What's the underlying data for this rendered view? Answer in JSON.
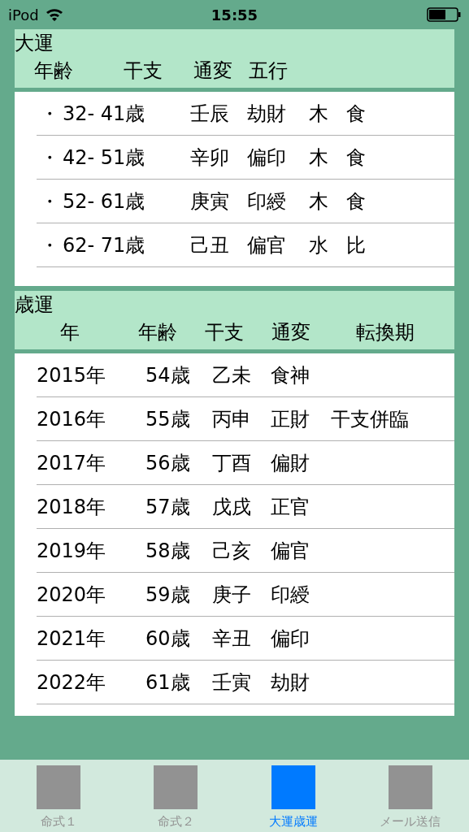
{
  "status_bar": {
    "carrier": "iPod",
    "time": "15:55"
  },
  "taiun": {
    "title": "大運",
    "columns": [
      "年齢",
      "干支",
      "通変",
      "五行"
    ],
    "rows": [
      {
        "bullet": "・",
        "age": "32- 41歳",
        "kanshi": "壬辰",
        "tsuhen": "劫財",
        "gogyo": "木",
        "extra": "食"
      },
      {
        "bullet": "・",
        "age": "42- 51歳",
        "kanshi": "辛卯",
        "tsuhen": "偏印",
        "gogyo": "木",
        "extra": "食"
      },
      {
        "bullet": "・",
        "age": "52- 61歳",
        "kanshi": "庚寅",
        "tsuhen": "印綬",
        "gogyo": "木",
        "extra": "食"
      },
      {
        "bullet": "・",
        "age": "62- 71歳",
        "kanshi": "己丑",
        "tsuhen": "偏官",
        "gogyo": "水",
        "extra": "比"
      }
    ]
  },
  "saiun": {
    "title": "歳運",
    "columns": [
      "年",
      "年齢",
      "干支",
      "通変",
      "転換期"
    ],
    "rows": [
      {
        "year": "2015年",
        "age": "54歳",
        "kanshi": "乙未",
        "tsuhen": "食神"
      },
      {
        "year": "2016年",
        "age": "55歳",
        "kanshi": "丙申",
        "tsuhen": "正財",
        "tenkan": "干支併臨"
      },
      {
        "year": "2017年",
        "age": "56歳",
        "kanshi": "丁酉",
        "tsuhen": "偏財"
      },
      {
        "year": "2018年",
        "age": "57歳",
        "kanshi": "戊戌",
        "tsuhen": "正官"
      },
      {
        "year": "2019年",
        "age": "58歳",
        "kanshi": "己亥",
        "tsuhen": "偏官"
      },
      {
        "year": "2020年",
        "age": "59歳",
        "kanshi": "庚子",
        "tsuhen": "印綬"
      },
      {
        "year": "2021年",
        "age": "60歳",
        "kanshi": "辛丑",
        "tsuhen": "偏印"
      },
      {
        "year": "2022年",
        "age": "61歳",
        "kanshi": "壬寅",
        "tsuhen": "劫財"
      }
    ]
  },
  "tabs": [
    {
      "label": "命式１",
      "selected": false
    },
    {
      "label": "命式２",
      "selected": false
    },
    {
      "label": "大運歳運",
      "selected": true
    },
    {
      "label": "メール送信",
      "selected": false
    }
  ]
}
